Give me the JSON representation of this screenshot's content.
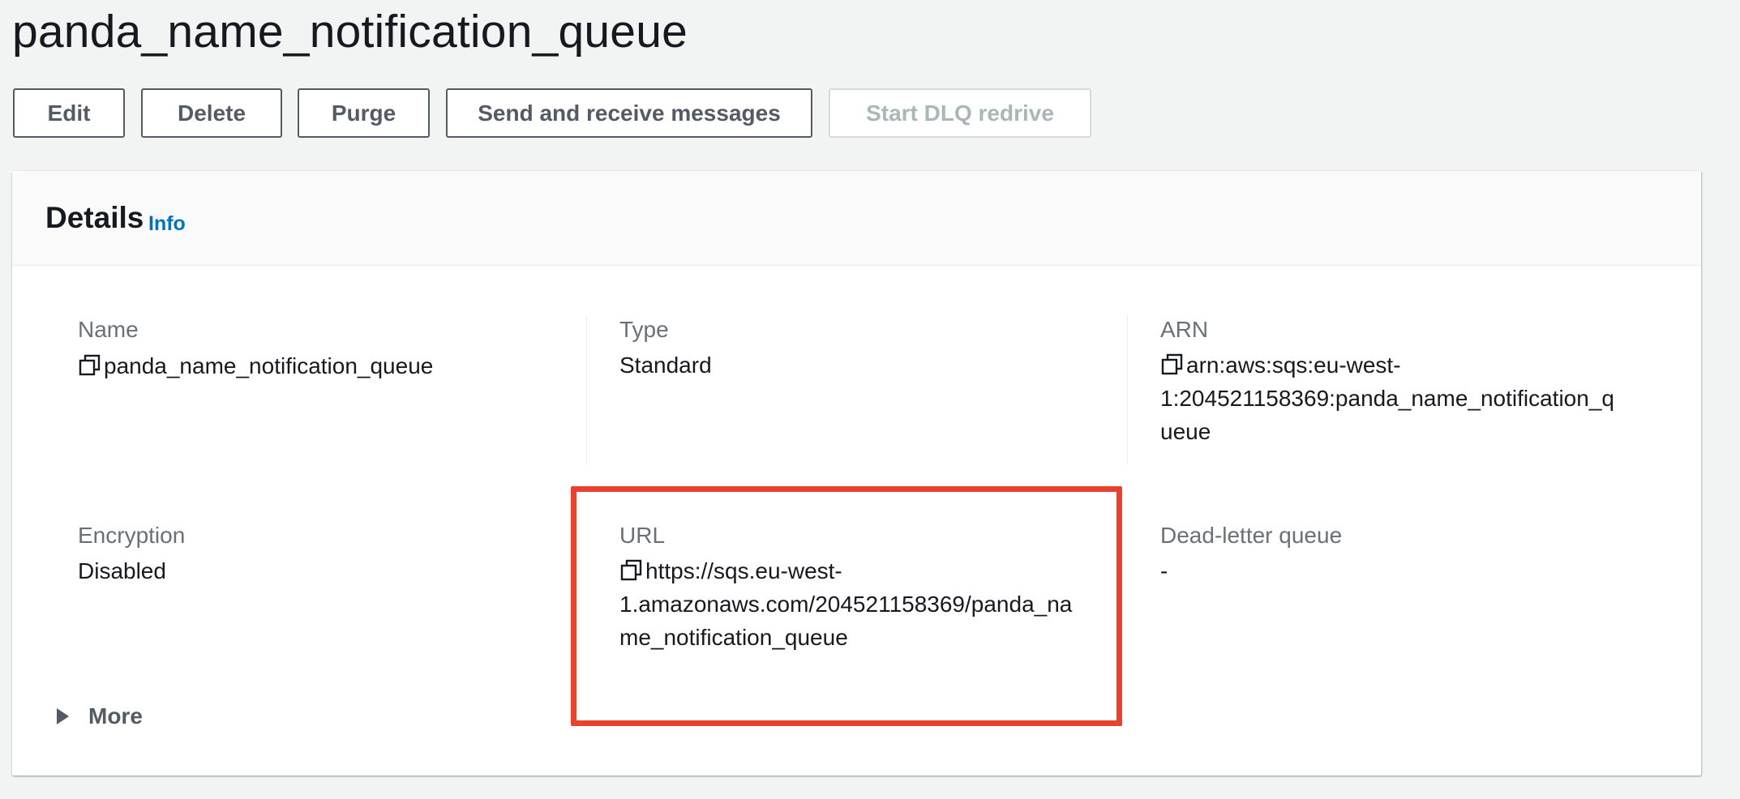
{
  "page": {
    "title": "panda_name_notification_queue"
  },
  "toolbar": {
    "edit_label": "Edit",
    "delete_label": "Delete",
    "purge_label": "Purge",
    "send_receive_label": "Send and receive messages",
    "start_dlq_label": "Start DLQ redrive"
  },
  "details": {
    "title": "Details",
    "info_label": "Info",
    "name_label": "Name",
    "name_value": "panda_name_notification_queue",
    "type_label": "Type",
    "type_value": "Standard",
    "arn_label": "ARN",
    "arn_line1": "arn:aws:sqs:eu-west-",
    "arn_line2": "1:204521158369:panda_name_notification_q",
    "arn_line3": "ueue",
    "encryption_label": "Encryption",
    "encryption_value": "Disabled",
    "url_label": "URL",
    "url_line1": "https://sqs.eu-west-",
    "url_line2": "1.amazonaws.com/204521158369/panda_na",
    "url_line3": "me_notification_queue",
    "dlq_label": "Dead-letter queue",
    "dlq_value": "-",
    "more_label": "More"
  },
  "colors": {
    "accent_link": "#0073bb",
    "highlight": "#e8412f",
    "button_text": "#545b64",
    "disabled_text": "#aab7b8"
  },
  "icons": {
    "copy": "copy-icon",
    "more_caret": "caret-right-icon"
  }
}
